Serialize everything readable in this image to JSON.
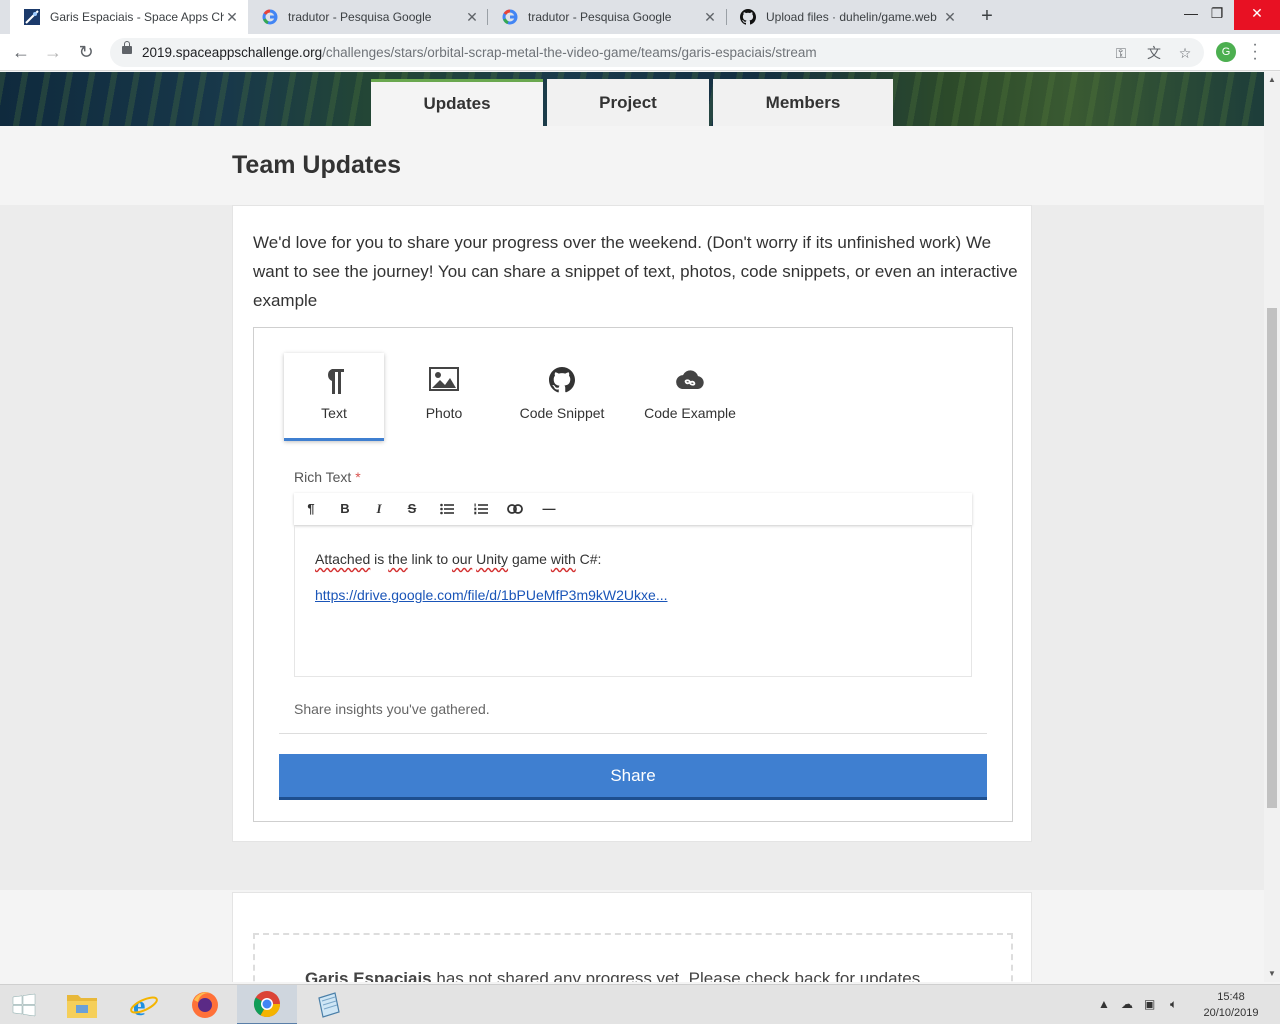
{
  "browser": {
    "tabs": [
      {
        "title": "Garis Espaciais - Space Apps Chal",
        "icon": "space-apps-icon",
        "active": true
      },
      {
        "title": "tradutor - Pesquisa Google",
        "icon": "google-icon",
        "active": false
      },
      {
        "title": "tradutor - Pesquisa Google",
        "icon": "google-icon",
        "active": false
      },
      {
        "title": "Upload files · duhelin/game.web",
        "icon": "github-icon",
        "active": false
      }
    ],
    "new_tab": "+",
    "url_domain": "2019.spaceappschallenge.org",
    "url_path": "/challenges/stars/orbital-scrap-metal-the-video-game/teams/garis-espaciais/stream",
    "profile_initial": "G"
  },
  "page_tabs": [
    {
      "label": "Updates",
      "active": true
    },
    {
      "label": "Project",
      "active": false
    },
    {
      "label": "Members",
      "active": false
    }
  ],
  "section_title": "Team Updates",
  "intro_text": "We'd love for you to share your progress over the weekend. (Don't worry if its unfinished work) We want to see the journey! You can share a snippet of text, photos, code snippets, or even an interactive example",
  "composer": {
    "types": [
      {
        "label": "Text",
        "icon": "paragraph-icon",
        "active": true
      },
      {
        "label": "Photo",
        "icon": "image-icon",
        "active": false
      },
      {
        "label": "Code Snippet",
        "icon": "github-icon",
        "active": false
      },
      {
        "label": "Code Example",
        "icon": "cloud-link-icon",
        "active": false
      }
    ],
    "rich_text_label": "Rich Text",
    "required_mark": "*",
    "toolbar": [
      "¶",
      "B",
      "I",
      "S",
      "bullets",
      "numbered",
      "link",
      "—"
    ],
    "editor": {
      "line1_words": [
        "Attached",
        "is",
        "the",
        "link",
        "to",
        "our",
        "Unity",
        "game",
        "with",
        "C#:"
      ],
      "link": "https://drive.google.com/file/d/1bPUeMfP3m9kW2Ukxe..."
    },
    "insights_hint": "Share insights you've gathered.",
    "share_label": "Share"
  },
  "empty_state": {
    "team": "Garis Espaciais",
    "message": " has not shared any progress yet. Please check back for updates."
  },
  "taskbar": {
    "apps": [
      "windows-start",
      "file-explorer",
      "internet-explorer",
      "firefox",
      "chrome",
      "notepad"
    ],
    "time": "15:48",
    "date": "20/10/2019"
  },
  "colors": {
    "accent": "#3f7fd0",
    "tab_accent": "#6aa84f",
    "window_close": "#e81123"
  }
}
